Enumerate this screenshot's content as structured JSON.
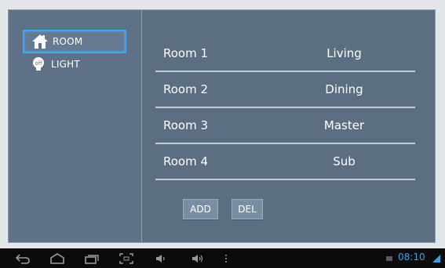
{
  "sidebar": {
    "items": [
      {
        "label": "ROOM",
        "icon": "house-icon"
      },
      {
        "label": "LIGHT",
        "icon": "light-bulb-icon"
      }
    ]
  },
  "rooms": [
    {
      "name": "Room 1",
      "type": "Living"
    },
    {
      "name": "Room 2",
      "type": "Dining"
    },
    {
      "name": "Room 3",
      "type": "Master"
    },
    {
      "name": "Room 4",
      "type": "Sub"
    }
  ],
  "buttons": {
    "add_label": "ADD",
    "del_label": "DEL"
  },
  "status_bar": {
    "time": "08:10"
  },
  "colors": {
    "panel": "#5b6e82",
    "selection": "#3fa9f5",
    "clock": "#36a2e8",
    "navbar": "#0b0b0b"
  }
}
